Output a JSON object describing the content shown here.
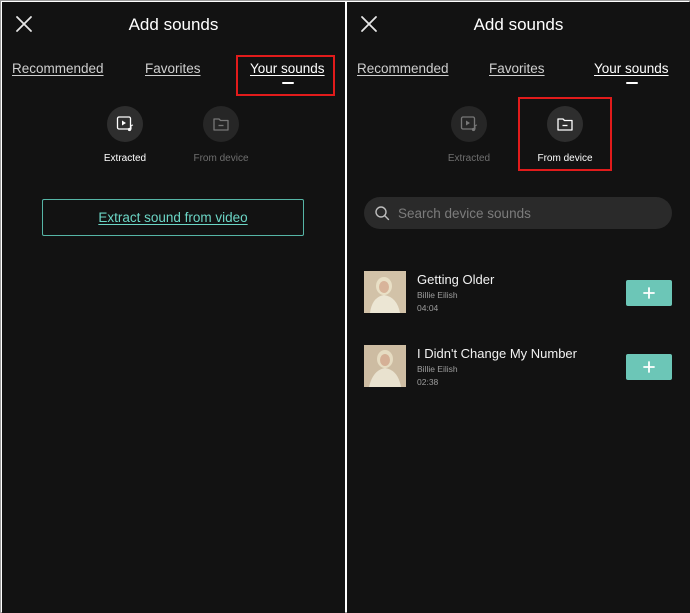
{
  "left": {
    "title": "Add sounds",
    "tabs": [
      "Recommended",
      "Favorites",
      "Your sounds"
    ],
    "sources": [
      {
        "label": "Extracted",
        "icon": "video-music-icon"
      },
      {
        "label": "From device",
        "icon": "folder-icon"
      }
    ],
    "extract_button": "Extract sound from video"
  },
  "right": {
    "title": "Add sounds",
    "tabs": [
      "Recommended",
      "Favorites",
      "Your sounds"
    ],
    "sources": [
      {
        "label": "Extracted",
        "icon": "video-music-icon"
      },
      {
        "label": "From device",
        "icon": "folder-icon"
      }
    ],
    "search_placeholder": "Search device sounds",
    "songs": [
      {
        "title": "Getting Older",
        "artist": "Billie Eilish",
        "duration": "04:04"
      },
      {
        "title": "I Didn't Change My Number",
        "artist": "Billie Eilish",
        "duration": "02:38"
      }
    ]
  },
  "colors": {
    "background": "#121212",
    "accent": "#6cc6b7",
    "highlight": "#e11b1b"
  }
}
